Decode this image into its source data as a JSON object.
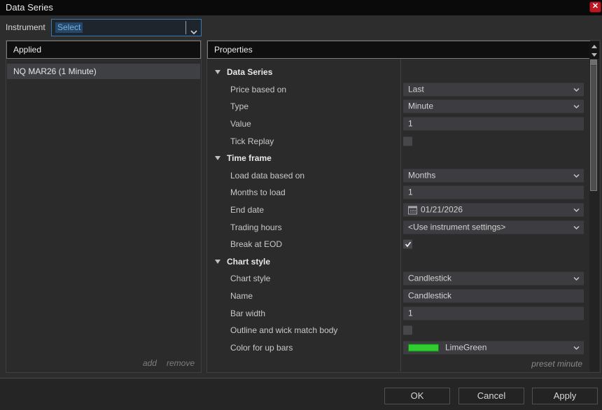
{
  "window": {
    "title": "Data Series"
  },
  "colors": {
    "accent_blue_border": "#3b79b5",
    "select_text_blue": "#79aede",
    "close_red": "#bf1722",
    "lime_green": "#32CD32",
    "selected_row_bg": "#3e4044"
  },
  "icons": {
    "close-icon": "x-cross",
    "chevron-down-icon": "v-chevron",
    "calendar-icon": "calendar-grid",
    "checkmark-icon": "check",
    "category-expander-icon": "triangle-down",
    "scroll-up-icon": "triangle-up",
    "scroll-down-icon": "triangle-down",
    "color-swatch": "limegreen-rectangle"
  },
  "instrument": {
    "label": "Instrument",
    "value": "Select"
  },
  "applied_panel": {
    "header": "Applied",
    "items": [
      {
        "label": "NQ MAR26 (1 Minute)",
        "selected": true
      }
    ],
    "add_label": "add",
    "remove_label": "remove"
  },
  "properties_panel": {
    "header": "Properties",
    "preset_label": "preset minute",
    "groups": [
      {
        "label": "Data Series",
        "rows": [
          {
            "label": "Price based on",
            "control": "dropdown",
            "value": "Last"
          },
          {
            "label": "Type",
            "control": "dropdown",
            "value": "Minute"
          },
          {
            "label": "Value",
            "control": "input",
            "value": "1"
          },
          {
            "label": "Tick Replay",
            "control": "checkbox",
            "checked": false
          }
        ]
      },
      {
        "label": "Time frame",
        "rows": [
          {
            "label": "Load data based on",
            "control": "dropdown",
            "value": "Months"
          },
          {
            "label": "Months to load",
            "control": "input",
            "value": "1"
          },
          {
            "label": "End date",
            "control": "date-dropdown",
            "value": "01/21/2026"
          },
          {
            "label": "Trading hours",
            "control": "dropdown",
            "value": "<Use instrument settings>"
          },
          {
            "label": "Break at EOD",
            "control": "checkbox",
            "checked": true
          }
        ]
      },
      {
        "label": "Chart style",
        "rows": [
          {
            "label": "Chart style",
            "control": "dropdown",
            "value": "Candlestick"
          },
          {
            "label": "Name",
            "control": "input",
            "value": "Candlestick"
          },
          {
            "label": "Bar width",
            "control": "input",
            "value": "1"
          },
          {
            "label": "Outline and wick match body",
            "control": "checkbox",
            "checked": false
          },
          {
            "label": "Color for up bars",
            "control": "color-dropdown",
            "value": "LimeGreen",
            "swatch": "#32CD32"
          }
        ]
      }
    ]
  },
  "footer": {
    "ok_label": "OK",
    "cancel_label": "Cancel",
    "apply_label": "Apply"
  }
}
